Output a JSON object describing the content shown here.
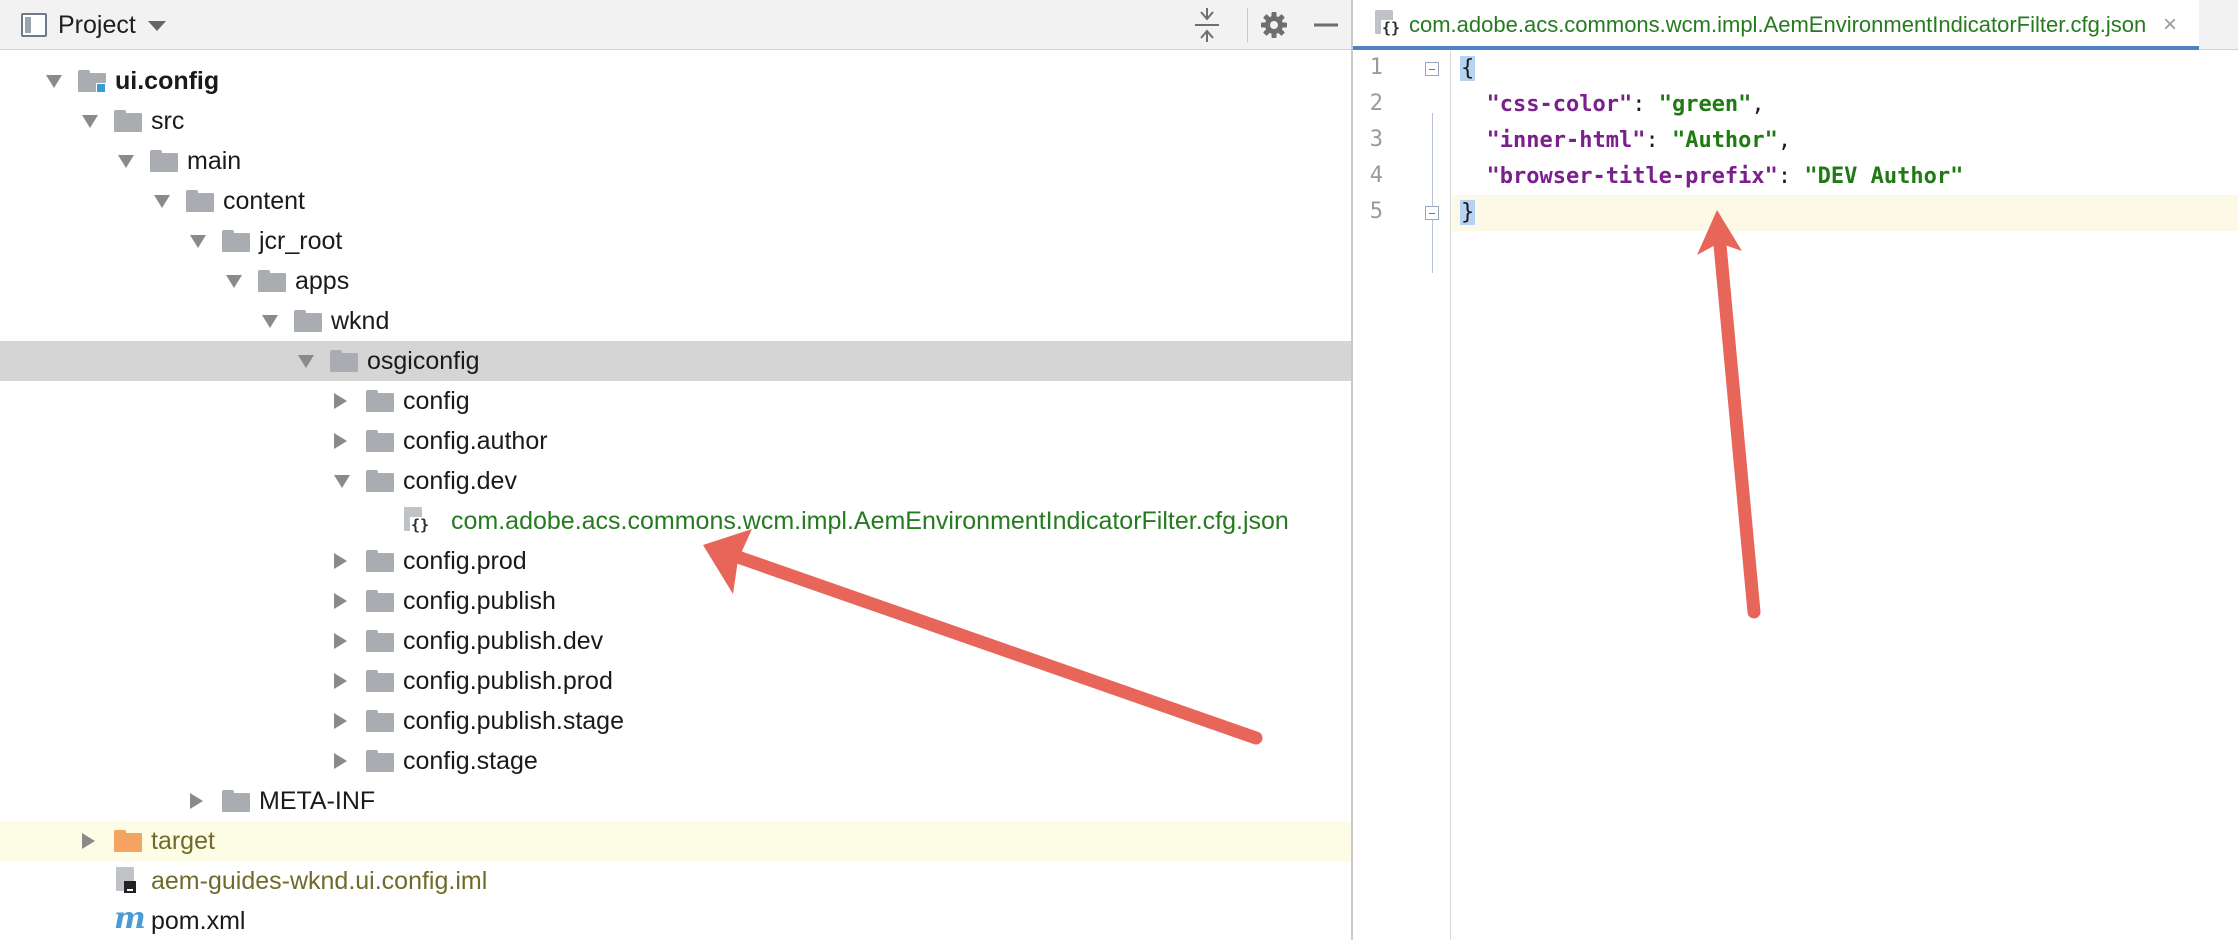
{
  "project_panel": {
    "title": "Project",
    "icons": {
      "collapse": "collapse-all-icon",
      "settings": "gear-icon",
      "minimize": "minimize-icon"
    }
  },
  "tree": [
    {
      "label": "ui.config",
      "indent": 0,
      "twisty": "open",
      "icon": "module-folder",
      "bold": true
    },
    {
      "label": "src",
      "indent": 1,
      "twisty": "open",
      "icon": "folder"
    },
    {
      "label": "main",
      "indent": 2,
      "twisty": "open",
      "icon": "folder"
    },
    {
      "label": "content",
      "indent": 3,
      "twisty": "open",
      "icon": "folder"
    },
    {
      "label": "jcr_root",
      "indent": 4,
      "twisty": "open",
      "icon": "folder"
    },
    {
      "label": "apps",
      "indent": 5,
      "twisty": "open",
      "icon": "folder"
    },
    {
      "label": "wknd",
      "indent": 6,
      "twisty": "open",
      "icon": "folder"
    },
    {
      "label": "osgiconfig",
      "indent": 7,
      "twisty": "open",
      "icon": "folder",
      "selected": true
    },
    {
      "label": "config",
      "indent": 8,
      "twisty": "closed",
      "icon": "folder"
    },
    {
      "label": "config.author",
      "indent": 8,
      "twisty": "closed",
      "icon": "folder"
    },
    {
      "label": "config.dev",
      "indent": 8,
      "twisty": "open",
      "icon": "folder"
    },
    {
      "label": "com.adobe.acs.commons.wcm.impl.AemEnvironmentIndicatorFilter.cfg.json",
      "indent": 9,
      "twisty": "none",
      "icon": "json-file",
      "color": "green"
    },
    {
      "label": "config.prod",
      "indent": 8,
      "twisty": "closed",
      "icon": "folder"
    },
    {
      "label": "config.publish",
      "indent": 8,
      "twisty": "closed",
      "icon": "folder"
    },
    {
      "label": "config.publish.dev",
      "indent": 8,
      "twisty": "closed",
      "icon": "folder"
    },
    {
      "label": "config.publish.prod",
      "indent": 8,
      "twisty": "closed",
      "icon": "folder"
    },
    {
      "label": "config.publish.stage",
      "indent": 8,
      "twisty": "closed",
      "icon": "folder"
    },
    {
      "label": "config.stage",
      "indent": 8,
      "twisty": "closed",
      "icon": "folder"
    },
    {
      "label": "META-INF",
      "indent": 4,
      "twisty": "closed",
      "icon": "folder"
    },
    {
      "label": "target",
      "indent": 1,
      "twisty": "closed",
      "icon": "orange-folder",
      "color": "olive",
      "excluded": true
    },
    {
      "label": "aem-guides-wknd.ui.config.iml",
      "indent": 1,
      "twisty": "none",
      "icon": "iml-file",
      "color": "olive"
    },
    {
      "label": "pom.xml",
      "indent": 1,
      "twisty": "none",
      "icon": "maven-icon"
    }
  ],
  "editor": {
    "tab_title": "com.adobe.acs.commons.wcm.impl.AemEnvironmentIndicatorFilter.cfg.json",
    "close_glyph": "×",
    "lines": [
      {
        "num": "1",
        "tokens": [
          {
            "t": "{",
            "c": "brace"
          }
        ]
      },
      {
        "num": "2",
        "tokens": [
          {
            "t": "  ",
            "c": "punc"
          },
          {
            "t": "\"css-color\"",
            "c": "key"
          },
          {
            "t": ": ",
            "c": "punc"
          },
          {
            "t": "\"green\"",
            "c": "str"
          },
          {
            "t": ",",
            "c": "punc"
          }
        ]
      },
      {
        "num": "3",
        "tokens": [
          {
            "t": "  ",
            "c": "punc"
          },
          {
            "t": "\"inner-html\"",
            "c": "key"
          },
          {
            "t": ": ",
            "c": "punc"
          },
          {
            "t": "\"Author\"",
            "c": "str"
          },
          {
            "t": ",",
            "c": "punc"
          }
        ]
      },
      {
        "num": "4",
        "tokens": [
          {
            "t": "  ",
            "c": "punc"
          },
          {
            "t": "\"browser-title-prefix\"",
            "c": "key"
          },
          {
            "t": ": ",
            "c": "punc"
          },
          {
            "t": "\"DEV Author\"",
            "c": "str"
          }
        ]
      },
      {
        "num": "5",
        "tokens": [
          {
            "t": "}",
            "c": "brace"
          }
        ],
        "current": true
      }
    ]
  },
  "colors": {
    "selection": "#d5d5d5",
    "json_key": "#7a1f8c",
    "json_string": "#1f7a13",
    "file_green": "#267a1f",
    "annotation_arrow": "#e8655a",
    "tab_underline": "#4b84c6"
  }
}
